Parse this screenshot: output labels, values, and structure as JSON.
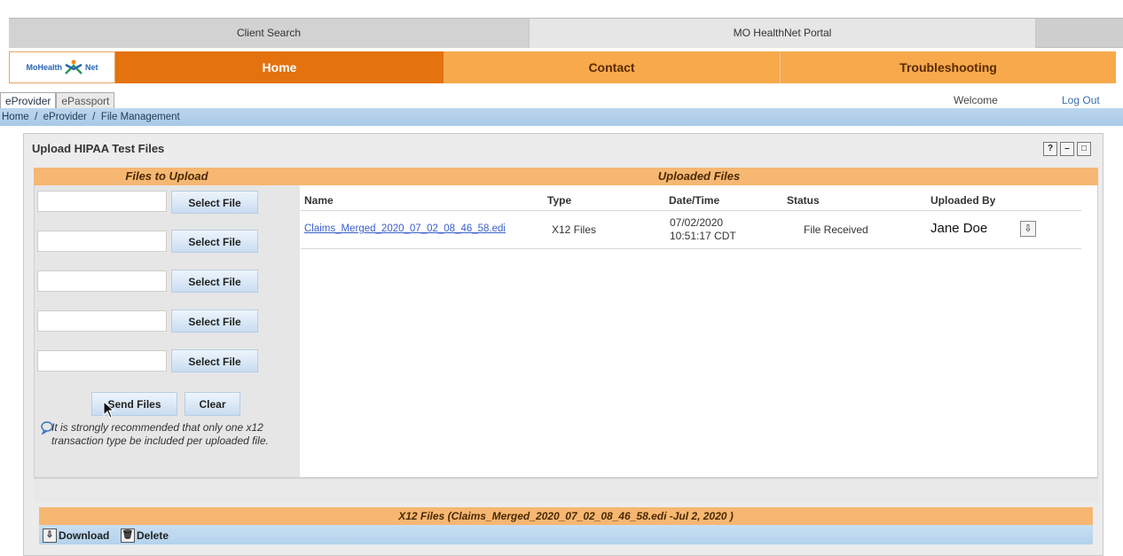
{
  "top_tabs": {
    "client_search": "Client Search",
    "portal": "MO HealthNet Portal"
  },
  "logo": {
    "text_left": "MoHealth",
    "text_right": "Net"
  },
  "nav": {
    "home": "Home",
    "contact": "Contact",
    "troubleshooting": "Troubleshooting"
  },
  "subtabs": {
    "eprovider": "eProvider",
    "epassport": "ePassport"
  },
  "header": {
    "welcome": "Welcome",
    "logout": "Log Out"
  },
  "breadcrumb": "Home  /  eProvider  /  File Management",
  "panel": {
    "title": "Upload HIPAA Test Files",
    "help": "?",
    "minimize": "–",
    "maximize": "□"
  },
  "upload": {
    "heading": "Files to Upload",
    "select_label": "Select File",
    "send_label": "Send Files",
    "clear_label": "Clear",
    "note": "It is strongly recommended that only one x12 transaction type be included per uploaded file."
  },
  "uploaded": {
    "heading": "Uploaded Files",
    "columns": [
      "Name",
      "Type",
      "Date/Time",
      "Status",
      "Uploaded By"
    ],
    "rows": [
      {
        "name": "Claims_Merged_2020_07_02_08_46_58.edi",
        "type": "X12 Files",
        "date": "07/02/2020",
        "time": "10:51:17 CDT",
        "status": "File Received",
        "uploaded_by": "Jane Doe"
      }
    ]
  },
  "x12": {
    "heading": "X12 Files (Claims_Merged_2020_07_02_08_46_58.edi -Jul 2, 2020 )",
    "download": "Download",
    "delete": "Delete"
  },
  "colors": {
    "nav_orange": "#f6a94c",
    "home_orange": "#e4720e",
    "section_orange": "#f6b773",
    "link_blue": "#3a5fcd"
  }
}
